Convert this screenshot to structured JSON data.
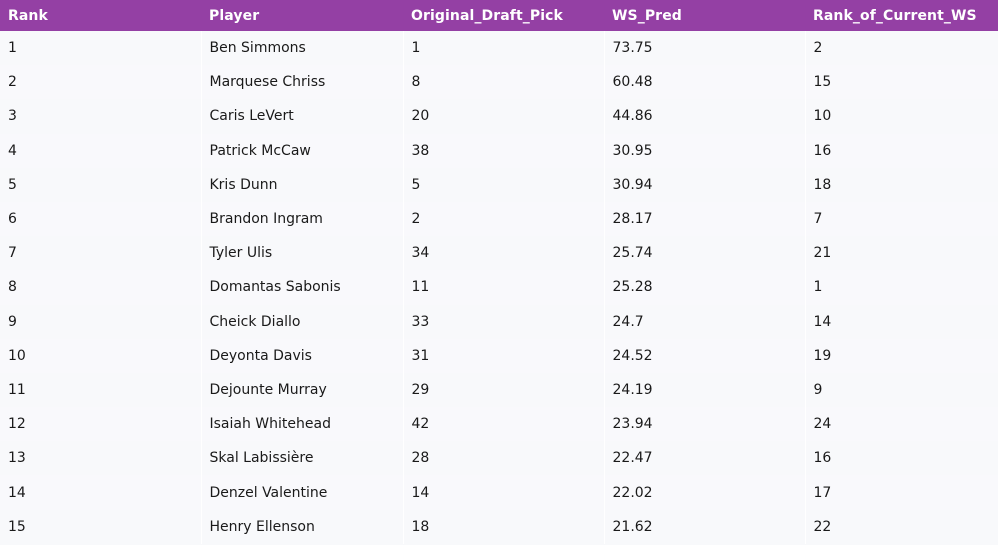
{
  "table": {
    "headers": [
      "Rank",
      "Player",
      "Original_Draft_Pick",
      "WS_Pred",
      "Rank_of_Current_WS"
    ],
    "rows": [
      [
        "1",
        "Ben Simmons",
        "1",
        "73.75",
        "2"
      ],
      [
        "2",
        "Marquese Chriss",
        "8",
        "60.48",
        "15"
      ],
      [
        "3",
        "Caris LeVert",
        "20",
        "44.86",
        "10"
      ],
      [
        "4",
        "Patrick McCaw",
        "38",
        "30.95",
        "16"
      ],
      [
        "5",
        "Kris Dunn",
        "5",
        "30.94",
        "18"
      ],
      [
        "6",
        "Brandon Ingram",
        "2",
        "28.17",
        "7"
      ],
      [
        "7",
        "Tyler Ulis",
        "34",
        "25.74",
        "21"
      ],
      [
        "8",
        "Domantas Sabonis",
        "11",
        "25.28",
        "1"
      ],
      [
        "9",
        "Cheick Diallo",
        "33",
        "24.7",
        "14"
      ],
      [
        "10",
        "Deyonta Davis",
        "31",
        "24.52",
        "19"
      ],
      [
        "11",
        "Dejounte Murray",
        "29",
        "24.19",
        "9"
      ],
      [
        "12",
        "Isaiah Whitehead",
        "42",
        "23.94",
        "24"
      ],
      [
        "13",
        "Skal Labissière",
        "28",
        "22.47",
        "16"
      ],
      [
        "14",
        "Denzel Valentine",
        "14",
        "22.02",
        "17"
      ],
      [
        "15",
        "Henry Ellenson",
        "18",
        "21.62",
        "22"
      ]
    ]
  },
  "colors": {
    "header_bg": "#9440a4",
    "header_text": "#ffffff",
    "body_bg": "#f8f9fb",
    "body_text": "#1a1a1a"
  }
}
